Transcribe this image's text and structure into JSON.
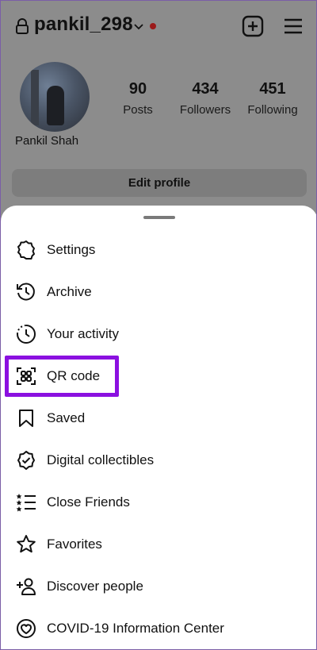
{
  "header": {
    "username": "pankil_298",
    "full_name": "Pankil Shah",
    "stats": [
      {
        "value": "90",
        "label": "Posts"
      },
      {
        "value": "434",
        "label": "Followers"
      },
      {
        "value": "451",
        "label": "Following"
      }
    ],
    "edit_profile_label": "Edit profile",
    "icons": [
      "lock-icon",
      "chevron-down-icon",
      "notification-dot",
      "create-plus-icon",
      "menu-icon"
    ]
  },
  "menu": {
    "items": [
      {
        "label": "Settings",
        "icon": "settings-icon"
      },
      {
        "label": "Archive",
        "icon": "archive-icon"
      },
      {
        "label": "Your activity",
        "icon": "activity-icon"
      },
      {
        "label": "QR code",
        "icon": "qr-code-icon",
        "highlighted": true
      },
      {
        "label": "Saved",
        "icon": "bookmark-icon"
      },
      {
        "label": "Digital collectibles",
        "icon": "verified-badge-icon"
      },
      {
        "label": "Close Friends",
        "icon": "close-friends-icon"
      },
      {
        "label": "Favorites",
        "icon": "star-icon"
      },
      {
        "label": "Discover people",
        "icon": "add-person-icon"
      },
      {
        "label": "COVID-19 Information Center",
        "icon": "covid-info-icon"
      }
    ]
  },
  "colors": {
    "highlight": "#8b10e0",
    "dim_overlay": "#8c8c8c",
    "status_dot": "#9b1a1a"
  }
}
